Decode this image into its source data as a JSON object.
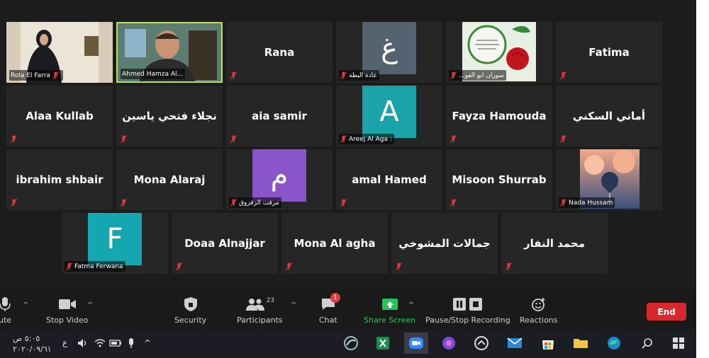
{
  "meeting": {
    "participants": [
      {
        "name": "Rola El Farra",
        "display": "video"
      },
      {
        "name": "Ahmed Hamza Al...",
        "display": "video",
        "active": true
      },
      {
        "name": "Rana",
        "display": "text"
      },
      {
        "name": "عادة البطة",
        "display": "avatar",
        "initial": "غ",
        "color": "#556270"
      },
      {
        "name": "...سوران ابو العو",
        "display": "photo"
      },
      {
        "name": "Fatima",
        "display": "text"
      },
      {
        "name": "Alaa Kullab",
        "display": "text"
      },
      {
        "name": "نجلاء فتحي ياسين",
        "display": "text"
      },
      {
        "name": "aia samir",
        "display": "text"
      },
      {
        "name": "Areej Al Aga :",
        "display": "avatar",
        "initial": "A",
        "color": "#1aa3a8"
      },
      {
        "name": "Fayza Hamouda",
        "display": "text"
      },
      {
        "name": "أماني السكني",
        "display": "text"
      },
      {
        "name": "ibrahim shbair",
        "display": "text"
      },
      {
        "name": "Mona Alaraj",
        "display": "text"
      },
      {
        "name": "مرفت الزقزوق",
        "display": "avatar",
        "initial": "م",
        "color": "#8a55c8"
      },
      {
        "name": "amal Hamed",
        "display": "text"
      },
      {
        "name": "Misoon  Shurrab",
        "display": "text"
      },
      {
        "name": "Nada Hussam",
        "display": "photo"
      },
      {
        "name": "Fatma Ferwana",
        "display": "avatar",
        "initial": "F",
        "color": "#14a7b0"
      },
      {
        "name": "Doaa Alnajjar",
        "display": "text"
      },
      {
        "name": "Mona Al agha",
        "display": "text"
      },
      {
        "name": "جمالات المشوخي",
        "display": "text"
      },
      {
        "name": "محمد النفار",
        "display": "text"
      }
    ]
  },
  "toolbar": {
    "mute_label": "ute",
    "video_label": "Stop Video",
    "security_label": "Security",
    "participants_label": "Participants",
    "participants_count": "23",
    "chat_label": "Chat",
    "chat_badge": "1",
    "share_label": "Share Screen",
    "record_label": "Pause/Stop Recording",
    "reactions_label": "Reactions",
    "end_label": "End"
  },
  "taskbar": {
    "time": "٥:٠٥ ص",
    "date": "٢٠٢٠/٠٩/٦١",
    "lang": "ع"
  },
  "colors": {
    "active_border": "#b7e24b",
    "end_button": "#d9272e",
    "share_green": "#23c45a",
    "muted_red": "#e0393e"
  }
}
